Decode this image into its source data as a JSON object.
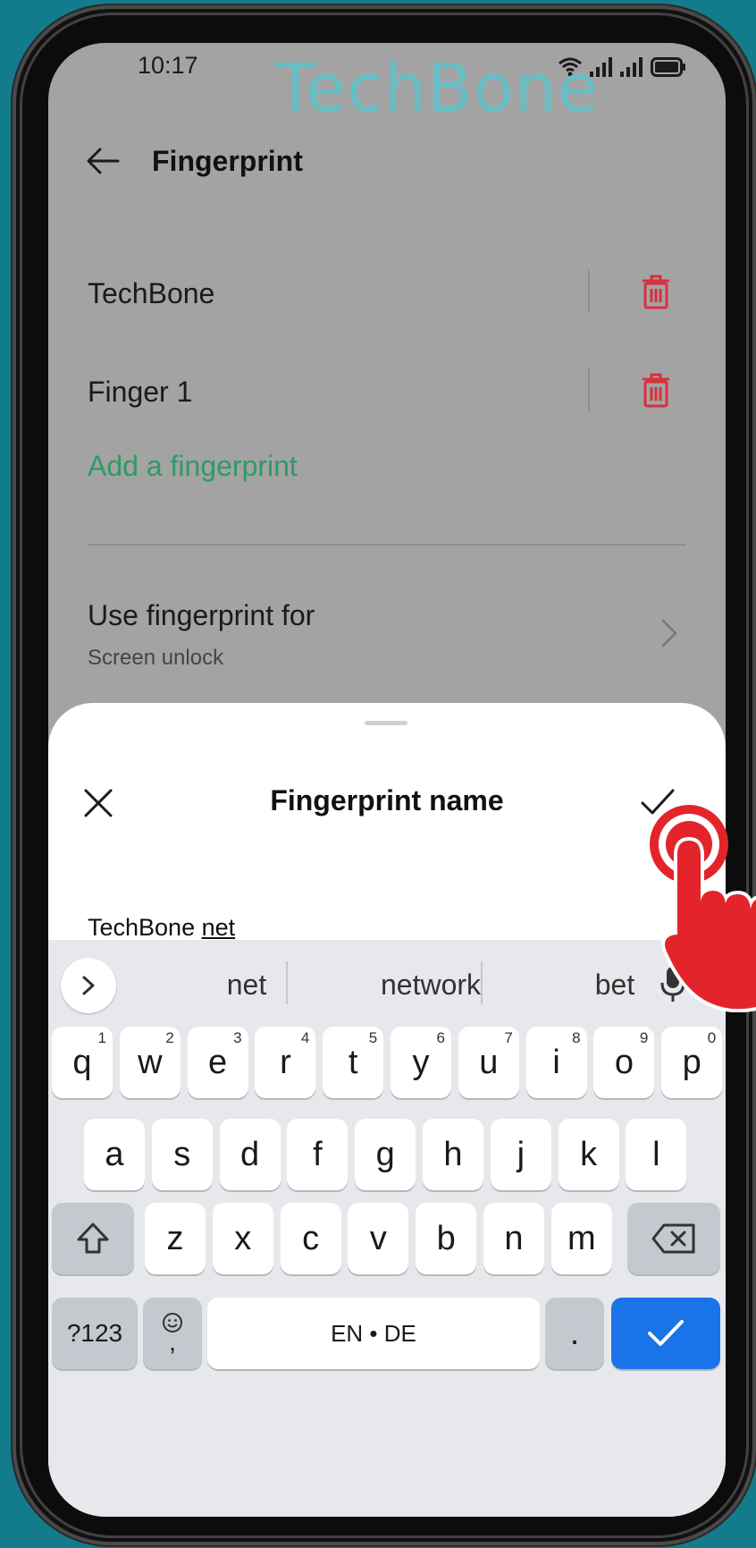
{
  "status_bar": {
    "time": "10:17"
  },
  "watermark": "TechBone",
  "header": {
    "title": "Fingerprint"
  },
  "fingerprints": [
    {
      "name": "TechBone"
    },
    {
      "name": "Finger 1"
    }
  ],
  "add_fingerprint_label": "Add a fingerprint",
  "use_fingerprint": {
    "label": "Use fingerprint for",
    "value": "Screen unlock"
  },
  "sheet": {
    "title": "Fingerprint name",
    "input_value_prefix": "TechBone ",
    "input_value_composing": "net"
  },
  "keyboard": {
    "suggestions": [
      "net",
      "network",
      "bet"
    ],
    "row1": [
      {
        "k": "q",
        "h": "1"
      },
      {
        "k": "w",
        "h": "2"
      },
      {
        "k": "e",
        "h": "3"
      },
      {
        "k": "r",
        "h": "4"
      },
      {
        "k": "t",
        "h": "5"
      },
      {
        "k": "y",
        "h": "6"
      },
      {
        "k": "u",
        "h": "7"
      },
      {
        "k": "i",
        "h": "8"
      },
      {
        "k": "o",
        "h": "9"
      },
      {
        "k": "p",
        "h": "0"
      }
    ],
    "row2": [
      "a",
      "s",
      "d",
      "f",
      "g",
      "h",
      "j",
      "k",
      "l"
    ],
    "row3": [
      "z",
      "x",
      "c",
      "v",
      "b",
      "n",
      "m"
    ],
    "symbols_label": "?123",
    "emoji_comma": ",",
    "space_label": "EN • DE",
    "period_label": "."
  },
  "colors": {
    "accent_green": "#2f9a64",
    "delete_red": "#d9303a",
    "enter_blue": "#1a73e8",
    "background_teal": "#137c8c"
  }
}
